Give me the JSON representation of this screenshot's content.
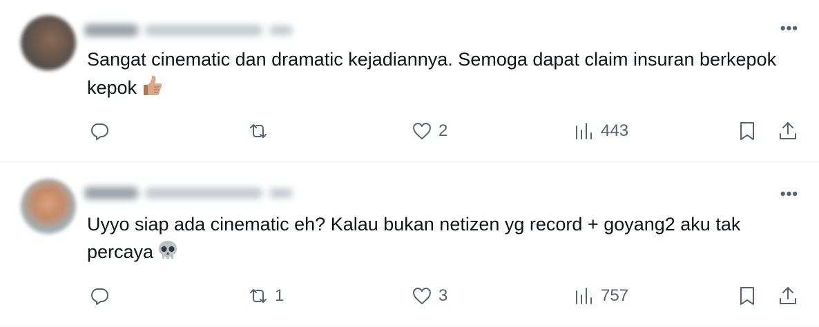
{
  "tweets": [
    {
      "text": "Sangat cinematic dan dramatic kejadiannya. Semoga dapat claim insuran berkepok kepok",
      "emoji": "thumbs-up",
      "more_label": "•••",
      "replies": "",
      "retweets": "",
      "likes": "2",
      "views": "443"
    },
    {
      "text": "Uyyo siap ada cinematic eh? Kalau bukan netizen yg record + goyang2 aku tak percaya",
      "emoji": "skull",
      "more_label": "•••",
      "replies": "",
      "retweets": "1",
      "likes": "3",
      "views": "757"
    }
  ],
  "icons": {
    "reply": "reply-icon",
    "retweet": "retweet-icon",
    "like": "heart-icon",
    "views": "views-bar-chart-icon",
    "bookmark": "bookmark-icon",
    "share": "share-icon"
  },
  "colors": {
    "text": "#0f1419",
    "secondary": "#536471",
    "divider": "#eff3f4"
  }
}
